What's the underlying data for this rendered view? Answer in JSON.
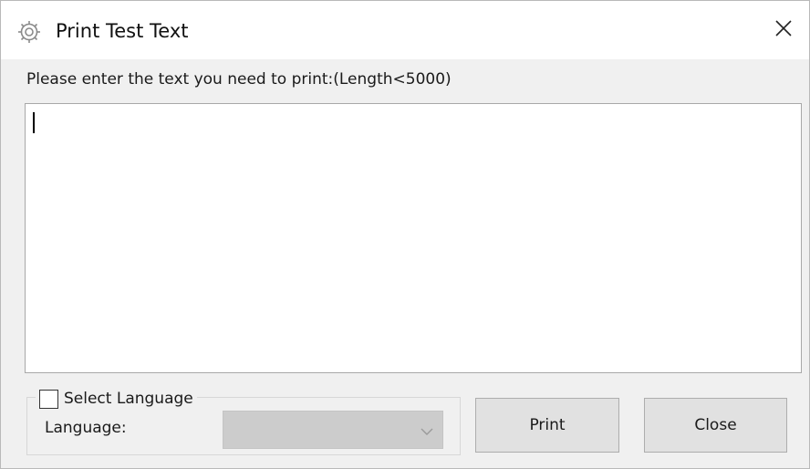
{
  "window": {
    "title": "Print Test Text",
    "icon": "gear-icon",
    "close_icon": "close-icon"
  },
  "prompt": {
    "label": "Please enter the text you need to print:(Length<5000)"
  },
  "text_input": {
    "value": ""
  },
  "language_group": {
    "checkbox_label": "Select Language",
    "checked": false,
    "language_label": "Language:",
    "language_value": "",
    "enabled": false
  },
  "buttons": {
    "print_label": "Print",
    "close_label": "Close"
  },
  "colors": {
    "dialog_background": "#f0f0f0",
    "titlebar_background": "#ffffff",
    "disabled_select": "#cccccc",
    "button_face": "#e1e1e1"
  }
}
